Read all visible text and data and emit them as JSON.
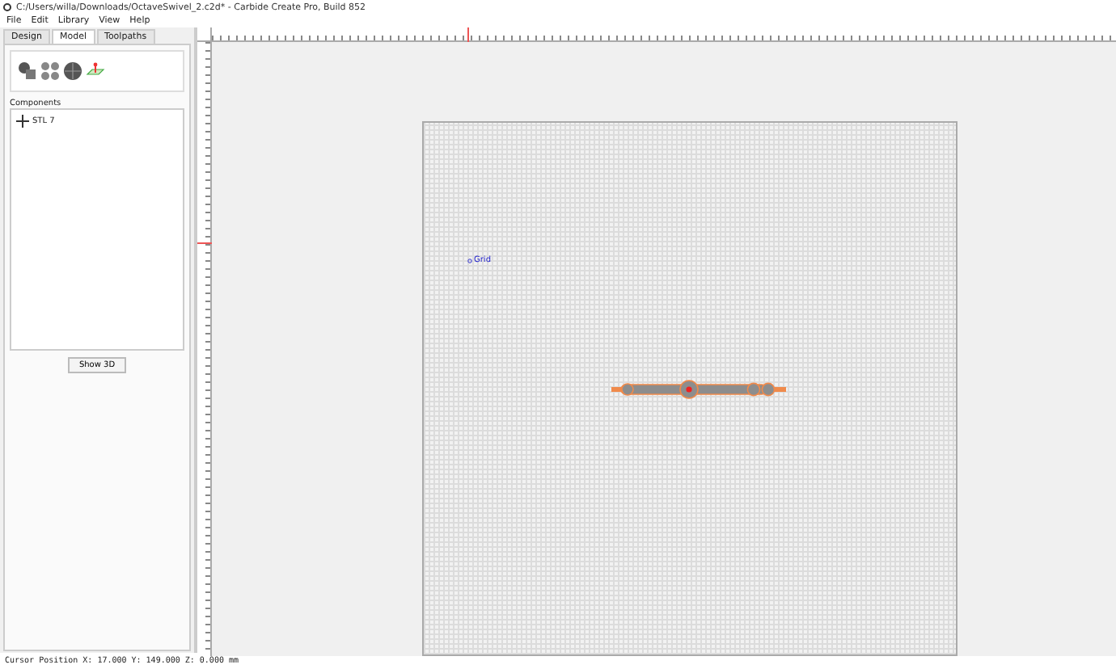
{
  "window": {
    "title": "C:/Users/willa/Downloads/OctaveSwivel_2.c2d* - Carbide Create Pro, Build 852"
  },
  "menu": [
    "File",
    "Edit",
    "Library",
    "View",
    "Help"
  ],
  "tabs": [
    {
      "label": "Design",
      "selected": false
    },
    {
      "label": "Model",
      "selected": true
    },
    {
      "label": "Toolpaths",
      "selected": false
    }
  ],
  "components": {
    "label": "Components",
    "items": [
      {
        "label": "STL 7"
      }
    ]
  },
  "show_3d_button": "Show 3D",
  "canvas": {
    "grid_label": "Grid"
  },
  "status_bar": "Cursor Position X: 17.000 Y: 149.000 Z: 0.000 mm"
}
